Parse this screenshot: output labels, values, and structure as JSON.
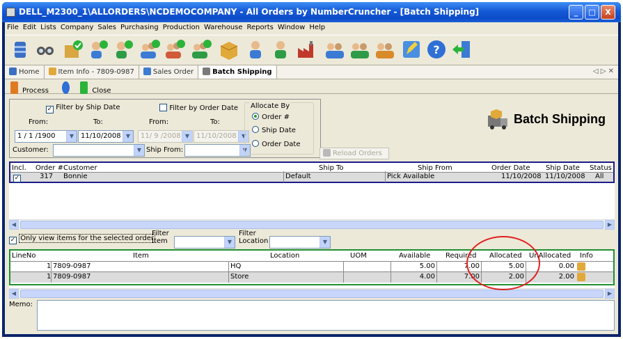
{
  "window": {
    "title": "DELL_M2300_1\\ALLORDERS\\NCDEMOCOMPANY - All Orders by NumberCruncher - [Batch Shipping]",
    "controls": [
      "_",
      "□",
      "X"
    ]
  },
  "menu": [
    "File",
    "Edit",
    "Lists",
    "Company",
    "Sales",
    "Purchasing",
    "Production",
    "Warehouse",
    "Reports",
    "Window",
    "Help"
  ],
  "toolbar_icons": [
    "database-icon",
    "binoculars-icon",
    "box-check-icon",
    "person-check-icon",
    "person-check-icon",
    "people-check-icon",
    "people-check-icon",
    "people-check-icon",
    "box-icon",
    "person-icon",
    "person-icon",
    "factory-icon",
    "people-icon",
    "people-icon",
    "people-icon",
    "edit-icon",
    "help-icon",
    "exit-icon"
  ],
  "tabs": [
    {
      "label": "Home",
      "active": false
    },
    {
      "label": "Item Info - 7809-0987",
      "active": false
    },
    {
      "label": "Sales Order",
      "active": false
    },
    {
      "label": "Batch Shipping",
      "active": true
    }
  ],
  "tab_nav": "◁ ▷ ✕",
  "subtoolbar": {
    "process": "Process",
    "close": "Close"
  },
  "filters": {
    "filter_by_ship_date": "Filter by Ship Date",
    "filter_by_order_date": "Filter by Order Date",
    "from": "From:",
    "to": "To:",
    "ship_from_date": "1 / 1 /1900",
    "ship_to_date": "11/10/2008",
    "order_from_date": "11/ 9 /2008",
    "order_to_date": "11/10/2008",
    "customer_label": "Customer:",
    "ship_from_label": "Ship From:",
    "allocate_by": "Allocate By",
    "alloc_options": [
      "Order #",
      "Ship Date",
      "Order Date"
    ],
    "reload": "Reload Orders"
  },
  "page_title": "Batch Shipping",
  "orders": {
    "headers": [
      "Incl.",
      "Order #",
      "Customer",
      "Ship To",
      "Ship From",
      "Order Date",
      "Ship Date",
      "Status"
    ],
    "rows": [
      {
        "incl": "✓",
        "order": "317",
        "customer": "Bonnie",
        "ship_to": "Default",
        "ship_from": "Pick Available",
        "order_date": "11/10/2008",
        "ship_date": "11/10/2008",
        "status": "All"
      }
    ]
  },
  "items_filter": {
    "only_selected": "Only view items for the selected order",
    "filter_item": "Filter Item",
    "filter_location": "Filter Location"
  },
  "items": {
    "headers": [
      "LineNo",
      "Item",
      "Location",
      "UOM",
      "Available",
      "Required",
      "Allocated",
      "Un",
      "Allocated",
      "Info"
    ],
    "rows": [
      {
        "line": "1",
        "item": "7809-0987",
        "location": "HQ",
        "uom": "",
        "available": "5.00",
        "required": "7.00",
        "allocated": "5.00",
        "unallocated": "0.00"
      },
      {
        "line": "1",
        "item": "7809-0987",
        "location": "Store",
        "uom": "",
        "available": "4.00",
        "required": "7.00",
        "allocated": "2.00",
        "unallocated": "2.00"
      }
    ]
  },
  "memo_label": "Memo:"
}
